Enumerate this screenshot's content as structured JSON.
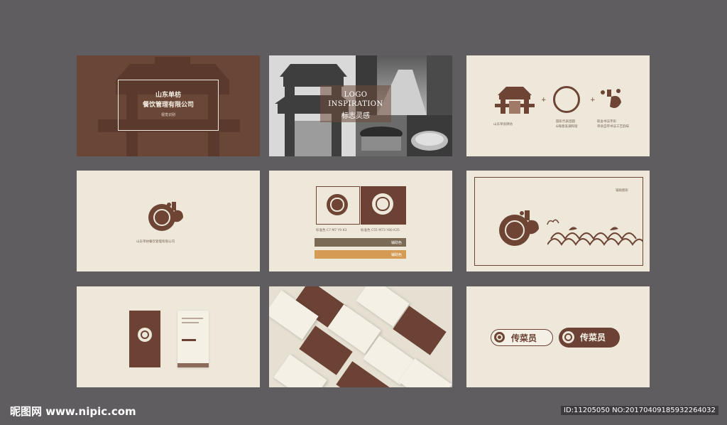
{
  "panel1": {
    "line1": "山东单枋",
    "line2": "餐饮管理有限公司",
    "line3": "视觉识别"
  },
  "panel2": {
    "title1": "LOGO",
    "title2": "INSPIRATION",
    "title3": "标志灵感"
  },
  "panel3": {
    "cap1": "山东单县牌坊",
    "cap2a": "圆形代表团圆",
    "cap2b": "&喻意美满和谐",
    "cap3a": "取舍书法字形",
    "cap3b": "单县自带书法工艺韵味"
  },
  "panel4": {
    "company": "山东单枋餐饮管理有限公司"
  },
  "panel5": {
    "label_std": "标准色 C7 M7 Y9 K3",
    "label_brown": "标准色 C55 M73 Y80 K35",
    "bar1": "辅助色",
    "bar2": "辅助色"
  },
  "panel6": {
    "label": "辅助图形"
  },
  "panel9": {
    "badge1": "传菜员",
    "badge2": "传菜员"
  },
  "watermark": {
    "site": "昵图网 www.nipic.com",
    "id": "ID:11205050 NO:20170409185932264032"
  },
  "colors": {
    "brown": "#6b4233",
    "cream": "#ede8da",
    "olive": "#7b6a55",
    "orange": "#d59b55",
    "bg": "#605d61"
  }
}
